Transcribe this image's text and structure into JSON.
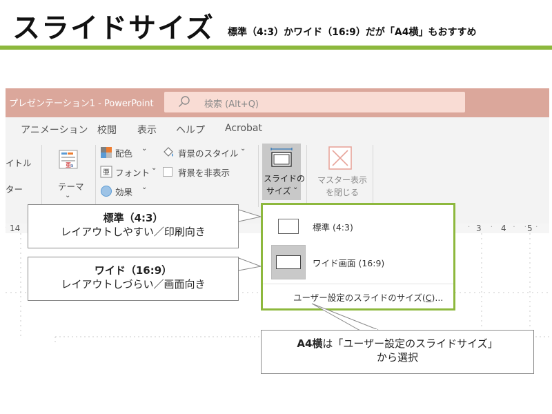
{
  "heading": {
    "title": "スライドサイズ",
    "subtitle": "標準（4:3）かワイド（16:9）だが「A4横」もおすすめ"
  },
  "window": {
    "title": "プレゼンテーション1  -  PowerPoint",
    "search_placeholder": "検索 (Alt+Q)"
  },
  "ribbon": {
    "tabs": [
      "アニメーション",
      "校閲",
      "表示",
      "ヘルプ",
      "Acrobat"
    ],
    "left_partial": [
      "イトル",
      "ター"
    ],
    "theme_label": "テーマ",
    "colors_label": "配色",
    "fonts_label": "フォント",
    "effects_label": "効果",
    "bg_style_label": "背景のスタイル",
    "hide_bg_label": "背景を非表示",
    "slide_size_label_1": "スライドの",
    "slide_size_label_2": "サイズ",
    "close_master_label_1": "マスター表示",
    "close_master_label_2": "を閉じる"
  },
  "ruler": {
    "left_number": "14",
    "right_numbers": [
      "3",
      "4",
      "5"
    ]
  },
  "dropdown": {
    "standard": "標準 (4:3)",
    "wide": "ワイド画面 (16:9)",
    "custom_prefix": "ユーザー設定のスライドのサイズ(",
    "custom_key": "C",
    "custom_suffix": ")..."
  },
  "callouts": {
    "standard_title": "標準（4:3）",
    "standard_desc": "レイアウトしやすい／印刷向き",
    "wide_title": "ワイド（16:9）",
    "wide_desc": "レイアウトしづらい／画面向き",
    "a4_bold": "A4横",
    "a4_rest": "は「ユーザー設定のスライドサイズ」",
    "a4_line2": "から選択"
  },
  "colors": {
    "accent_green": "#8db83d",
    "titlebar": "#dba79b",
    "search_bg": "#f9dcd4"
  }
}
